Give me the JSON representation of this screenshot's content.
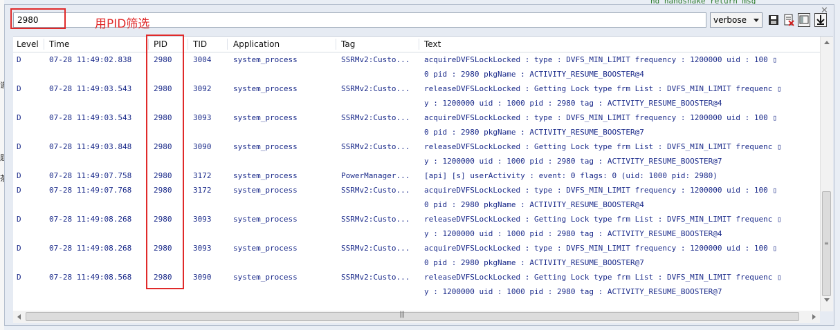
{
  "background": {
    "left_fragments": [
      "谢",
      "题",
      "茶"
    ],
    "top_fragment": "nd handshake return msg"
  },
  "filter": {
    "value": "2980"
  },
  "annotation": "用PID筛选",
  "log_level": {
    "selected": "verbose"
  },
  "toolbar": {
    "save_icon": "save-icon",
    "clear_icon": "clear-log-icon",
    "layout_icon": "layout-toggle-icon",
    "scroll_icon": "scroll-lock-icon"
  },
  "columns": {
    "level": "Level",
    "time": "Time",
    "pid": "PID",
    "tid": "TID",
    "application": "Application",
    "tag": "Tag",
    "text": "Text"
  },
  "rows": [
    {
      "level": "D",
      "time": "07-28 11:49:02.838",
      "pid": "2980",
      "tid": "3004",
      "app": "system_process",
      "tag": "SSRMv2:Custo...",
      "text1": "acquireDVFSLockLocked : type : DVFS_MIN_LIMIT  frequency : 1200000  uid : 100 ▯",
      "text2": "0  pid : 2980  pkgName : ACTIVITY_RESUME_BOOSTER@4"
    },
    {
      "level": "D",
      "time": "07-28 11:49:03.543",
      "pid": "2980",
      "tid": "3092",
      "app": "system_process",
      "tag": "SSRMv2:Custo...",
      "text1": "releaseDVFSLockLocked : Getting Lock type frm List : DVFS_MIN_LIMIT  frequenc ▯",
      "text2": "y : 1200000  uid : 1000  pid : 2980  tag : ACTIVITY_RESUME_BOOSTER@4"
    },
    {
      "level": "D",
      "time": "07-28 11:49:03.543",
      "pid": "2980",
      "tid": "3093",
      "app": "system_process",
      "tag": "SSRMv2:Custo...",
      "text1": "acquireDVFSLockLocked : type : DVFS_MIN_LIMIT  frequency : 1200000  uid : 100 ▯",
      "text2": "0  pid : 2980  pkgName : ACTIVITY_RESUME_BOOSTER@7"
    },
    {
      "level": "D",
      "time": "07-28 11:49:03.848",
      "pid": "2980",
      "tid": "3090",
      "app": "system_process",
      "tag": "SSRMv2:Custo...",
      "text1": "releaseDVFSLockLocked : Getting Lock type frm List : DVFS_MIN_LIMIT  frequenc ▯",
      "text2": "y : 1200000  uid : 1000  pid : 2980  tag : ACTIVITY_RESUME_BOOSTER@7"
    },
    {
      "level": "D",
      "time": "07-28 11:49:07.758",
      "pid": "2980",
      "tid": "3172",
      "app": "system_process",
      "tag": "PowerManager...",
      "text1": "[api] [s] userActivity : event: 0 flags: 0 (uid: 1000 pid: 2980)",
      "text2": ""
    },
    {
      "level": "D",
      "time": "07-28 11:49:07.768",
      "pid": "2980",
      "tid": "3172",
      "app": "system_process",
      "tag": "SSRMv2:Custo...",
      "text1": "acquireDVFSLockLocked : type : DVFS_MIN_LIMIT  frequency : 1200000  uid : 100 ▯",
      "text2": "0  pid : 2980  pkgName : ACTIVITY_RESUME_BOOSTER@4"
    },
    {
      "level": "D",
      "time": "07-28 11:49:08.268",
      "pid": "2980",
      "tid": "3093",
      "app": "system_process",
      "tag": "SSRMv2:Custo...",
      "text1": "releaseDVFSLockLocked : Getting Lock type frm List : DVFS_MIN_LIMIT  frequenc ▯",
      "text2": "y : 1200000  uid : 1000  pid : 2980  tag : ACTIVITY_RESUME_BOOSTER@4"
    },
    {
      "level": "D",
      "time": "07-28 11:49:08.268",
      "pid": "2980",
      "tid": "3093",
      "app": "system_process",
      "tag": "SSRMv2:Custo...",
      "text1": "acquireDVFSLockLocked : type : DVFS_MIN_LIMIT  frequency : 1200000  uid : 100 ▯",
      "text2": "0  pid : 2980  pkgName : ACTIVITY_RESUME_BOOSTER@7"
    },
    {
      "level": "D",
      "time": "07-28 11:49:08.568",
      "pid": "2980",
      "tid": "3090",
      "app": "system_process",
      "tag": "SSRMv2:Custo...",
      "text1": "releaseDVFSLockLocked : Getting Lock type frm List : DVFS_MIN_LIMIT  frequenc ▯",
      "text2": "y : 1200000  uid : 1000  pid : 2980  tag : ACTIVITY_RESUME_BOOSTER@7"
    }
  ]
}
